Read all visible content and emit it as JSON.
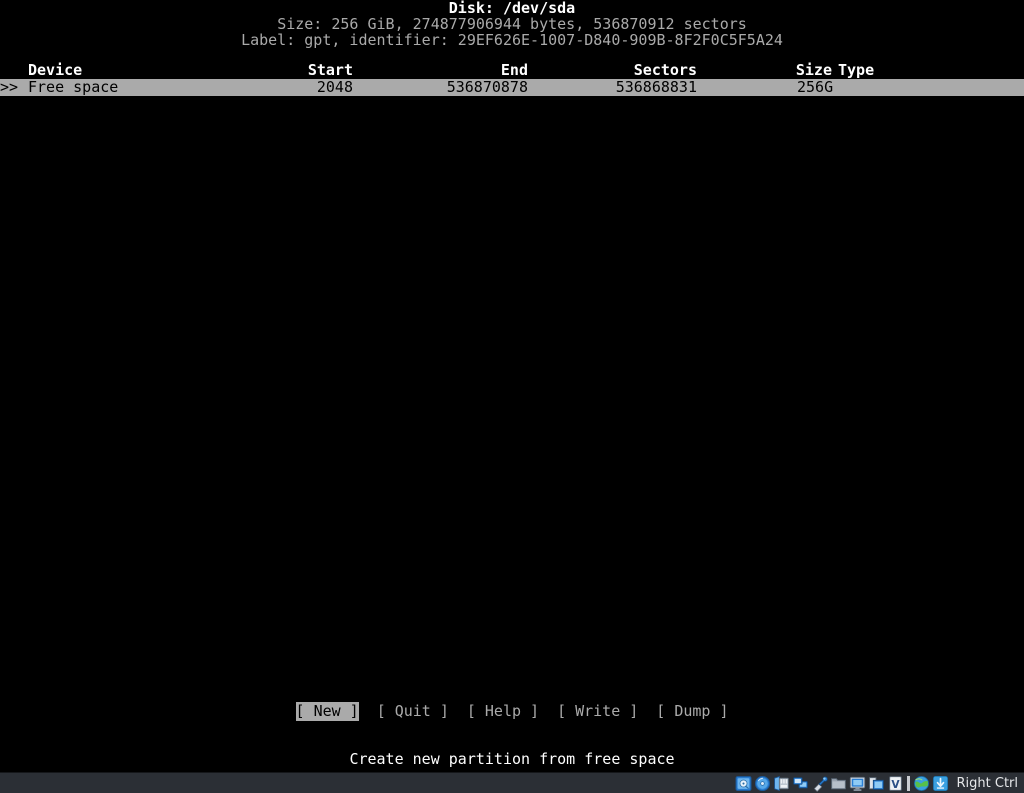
{
  "app": {
    "name": "cfdisk",
    "host_key_label": "Right Ctrl"
  },
  "colors": {
    "terminal_bg": "#000000",
    "terminal_fg": "#aaaaaa",
    "bright_fg": "#ffffff",
    "selection_bg": "#aaaaaa",
    "selection_fg": "#000000",
    "statusbar_bg": "#2b2f35"
  },
  "header": {
    "disk_line": "Disk: /dev/sda",
    "size_line": "Size: 256 GiB, 274877906944 bytes, 536870912 sectors",
    "label_line": "Label: gpt, identifier: 29EF626E-1007-D840-909B-8F2F0C5F5A24"
  },
  "table": {
    "columns": {
      "device": "Device",
      "start": "Start",
      "end": "End",
      "sectors": "Sectors",
      "size": "Size",
      "type": "Type"
    },
    "rows": [
      {
        "marker": ">>",
        "device": "Free space",
        "start": "2048",
        "end": "536870878",
        "sectors": "536868831",
        "size": "256G",
        "type": "",
        "selected": true
      }
    ]
  },
  "menu": {
    "items": [
      {
        "label": "New",
        "bracket_open": "[",
        "bracket_close": "]",
        "active": true
      },
      {
        "label": "Quit",
        "bracket_open": "[",
        "bracket_close": "]",
        "active": false
      },
      {
        "label": "Help",
        "bracket_open": "[",
        "bracket_close": "]",
        "active": false
      },
      {
        "label": "Write",
        "bracket_open": "[",
        "bracket_close": "]",
        "active": false
      },
      {
        "label": "Dump",
        "bracket_open": "[",
        "bracket_close": "]",
        "active": false
      }
    ]
  },
  "status": {
    "hint": "Create new partition from free space"
  },
  "statusbar": {
    "icons": [
      {
        "name": "hard-disk-icon",
        "title": "Hard Disks"
      },
      {
        "name": "optical-disk-icon",
        "title": "Optical Drives"
      },
      {
        "name": "floppy-disk-icon",
        "title": "Floppy Drives"
      },
      {
        "name": "network-icon",
        "title": "Network"
      },
      {
        "name": "usb-icon",
        "title": "USB Devices"
      },
      {
        "name": "shared-folder-icon",
        "title": "Shared Folders"
      },
      {
        "name": "display-icon",
        "title": "Display"
      },
      {
        "name": "drag-and-drop-icon",
        "title": "Drag and Drop"
      },
      {
        "name": "recording-icon",
        "title": "Recording"
      },
      {
        "name": "separator",
        "title": ""
      },
      {
        "name": "guest-additions-icon",
        "title": "Guest Additions"
      },
      {
        "name": "host-key-icon",
        "title": "Host Key"
      }
    ]
  }
}
